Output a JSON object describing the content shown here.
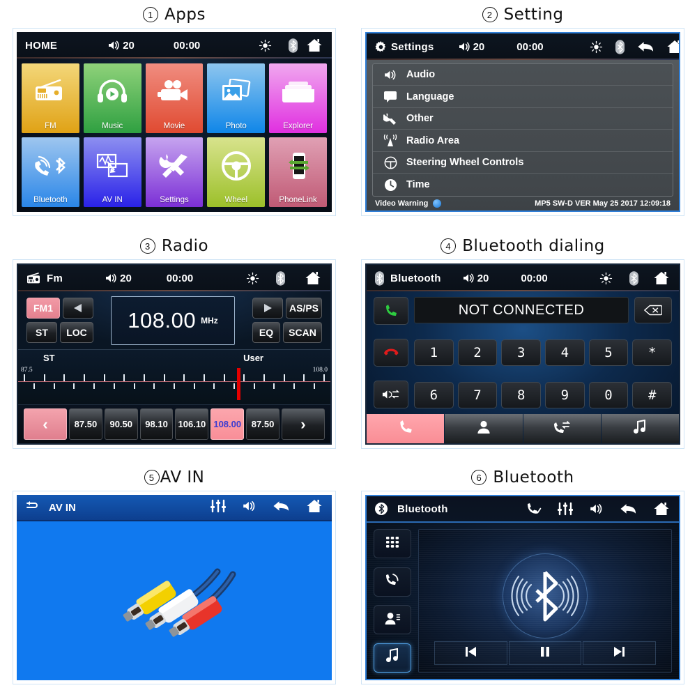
{
  "panels": [
    {
      "num": "①",
      "title": "Apps",
      "status": {
        "title": "HOME",
        "volume": "20",
        "clock": "00:00"
      },
      "tiles": [
        {
          "label": "FM",
          "icon": "radio-icon",
          "c1": "#f3d77a",
          "c2": "#e0a215"
        },
        {
          "label": "Music",
          "icon": "headphones-icon",
          "c1": "#8fd27a",
          "c2": "#2fa041"
        },
        {
          "label": "Movie",
          "icon": "camcorder-icon",
          "c1": "#f08d80",
          "c2": "#e04a31"
        },
        {
          "label": "Photo",
          "icon": "photos-icon",
          "c1": "#8ec6ef",
          "c2": "#0f86e8"
        },
        {
          "label": "Explorer",
          "icon": "folder-icon",
          "c1": "#f0a8ef",
          "c2": "#e02fe0"
        },
        {
          "label": "Bluetooth",
          "icon": "bt-phone-icon",
          "c1": "#9ec6ef",
          "c2": "#2a86e8"
        },
        {
          "label": "AV IN",
          "icon": "av-in-icon",
          "c1": "#8d8ff0",
          "c2": "#2a22e8"
        },
        {
          "label": "Settings",
          "icon": "tools-icon",
          "c1": "#c6a4ef",
          "c2": "#7b2fd6"
        },
        {
          "label": "Wheel",
          "icon": "steering-icon",
          "c1": "#d8e38d",
          "c2": "#9cc02a"
        },
        {
          "label": "PhoneLink",
          "icon": "phonelink-icon",
          "c1": "#e0a0b4",
          "c2": "#c05a75"
        }
      ]
    },
    {
      "num": "②",
      "title": "Setting",
      "status": {
        "title": "Settings",
        "volume": "20",
        "clock": "00:00"
      },
      "items": [
        {
          "label": "Audio",
          "icon": "speaker-icon"
        },
        {
          "label": "Language",
          "icon": "speech-bubble-icon"
        },
        {
          "label": "Other",
          "icon": "wrench-icon"
        },
        {
          "label": "Radio Area",
          "icon": "antenna-icon"
        },
        {
          "label": "Steering Wheel Controls",
          "icon": "steering-wheel-icon"
        },
        {
          "label": "Time",
          "icon": "clock-icon"
        }
      ],
      "footer": {
        "left": "Video Warning",
        "right": "MP5 SW-D VER May 25 2017 12:09:18"
      }
    },
    {
      "num": "③",
      "title": "Radio",
      "status": {
        "title": "Fm",
        "volume": "20",
        "clock": "00:00"
      },
      "band": "FM1",
      "buttons": {
        "st": "ST",
        "loc": "LOC",
        "asps": "AS/PS",
        "eq": "EQ",
        "scan": "SCAN"
      },
      "frequency": "108.00",
      "unit": "MHz",
      "scale": {
        "left_label": "ST",
        "right_label": "User",
        "min": "87.5",
        "max": "108.0",
        "needle_pct": 70
      },
      "presets": [
        "87.50",
        "90.50",
        "98.10",
        "106.10",
        "108.00",
        "87.50"
      ],
      "selected_preset_index": 4,
      "prev_label": "‹",
      "next_label": "›"
    },
    {
      "num": "④",
      "title": "Bluetooth dialing",
      "status": {
        "title": "Bluetooth",
        "volume": "20",
        "clock": "00:00"
      },
      "display": "NOT CONNECTED",
      "keys_row1": [
        "1",
        "2",
        "3",
        "4",
        "5",
        "*"
      ],
      "keys_row2": [
        "6",
        "7",
        "8",
        "9",
        "0",
        "#"
      ],
      "side_buttons": [
        "call-answer-icon",
        "call-end-icon",
        "audio-transfer-icon"
      ],
      "delete_icon": "backspace-icon",
      "tabs": [
        "dialpad-tab-icon",
        "contacts-tab-icon",
        "call-history-tab-icon",
        "bt-music-tab-icon"
      ],
      "active_tab_index": 0
    },
    {
      "num": "⑤",
      "title": "AV IN",
      "status": {
        "title": "AV IN",
        "icons": [
          "equalizer-icon",
          "speaker-icon",
          "back-icon",
          "home-icon"
        ]
      },
      "artwork": "rca-cable-image"
    },
    {
      "num": "⑥",
      "title": "Bluetooth",
      "status": {
        "title": "Bluetooth",
        "icons": [
          "phone-icon",
          "equalizer-icon",
          "speaker-icon",
          "back-icon",
          "home-icon"
        ]
      },
      "side_buttons": [
        "dialpad-icon",
        "call-icon",
        "contacts-icon",
        "music-icon"
      ],
      "active_side_index": 3,
      "transport": [
        "prev-track-icon",
        "pause-icon",
        "next-track-icon"
      ],
      "center": "bluetooth-logo-icon"
    }
  ]
}
